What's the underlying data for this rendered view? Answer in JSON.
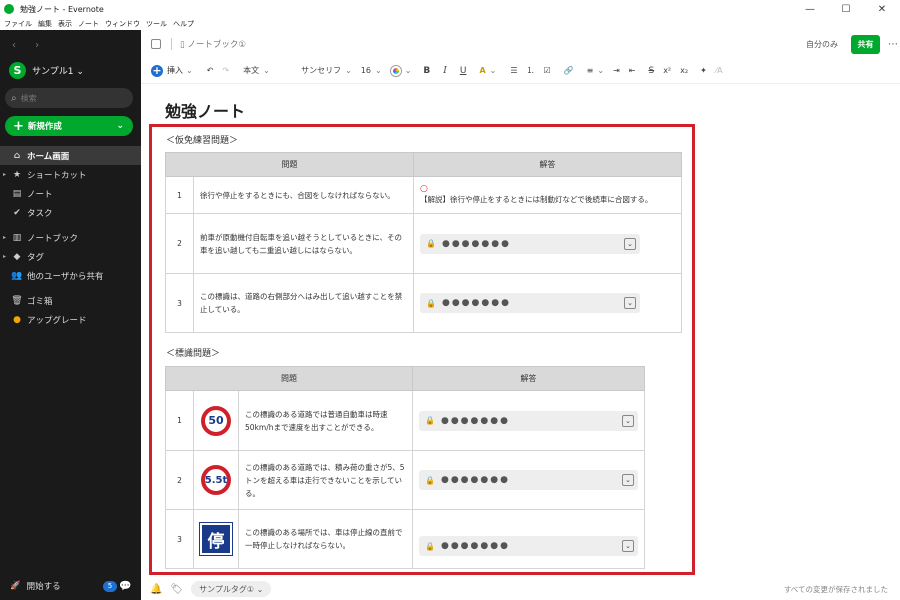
{
  "window": {
    "title": "勉強ノート - Evernote",
    "minimize": "—",
    "maximize": "☐",
    "close": "✕"
  },
  "menu": [
    "ファイル",
    "編集",
    "表示",
    "ノート",
    "ウィンドウ",
    "ツール",
    "ヘルプ"
  ],
  "sidebar": {
    "nav_arrows": "‹ ›",
    "account_initial": "S",
    "account_name": "サンプル1 ⌄",
    "search_placeholder": "検索",
    "search_icon": "⌕",
    "new_button": "新規作成",
    "items": [
      {
        "label": "ホーム画面",
        "icon": "⌂",
        "active": true
      },
      {
        "label": "ショートカット",
        "icon": "★",
        "caret": "▸"
      },
      {
        "label": "ノート",
        "icon": "▤"
      },
      {
        "label": "タスク",
        "icon": "✔"
      },
      {
        "label": "ノートブック",
        "icon": "▥",
        "caret": "▸"
      },
      {
        "label": "タグ",
        "icon": "◆",
        "caret": "▸"
      },
      {
        "label": "他のユーザから共有",
        "icon": "👥"
      },
      {
        "label": "ゴミ箱",
        "icon": "🗑"
      },
      {
        "label": "アップグレード",
        "icon": "●"
      }
    ],
    "footer_label": "開始する",
    "footer_badge": "5",
    "footer_icon": "🚀",
    "chat_icon": "💬"
  },
  "note_header": {
    "notebook": "ノートブック①",
    "notebook_icon": "▯",
    "owner": "自分のみ",
    "share": "共有",
    "more": "⋯"
  },
  "toolbar": {
    "insert": "挿入",
    "undo": "↶",
    "redo": "↷",
    "style": "本文",
    "font": "サンセリフ",
    "size": "16",
    "bold": "B",
    "italic": "I",
    "underline": "U",
    "highlight": "A",
    "bullets": "☰",
    "numbered": "⒈",
    "checklist": "☑",
    "link": "🔗",
    "align": "≡",
    "indent": "⇥",
    "outdent": "⇤",
    "strike": "S",
    "superscript": "x²",
    "subscript": "x₂",
    "magic": "✦",
    "format": "⁄A"
  },
  "note": {
    "title": "勉強ノート",
    "section1": {
      "title": "＜仮免練習問題＞",
      "headers": [
        "問題",
        "解答"
      ],
      "rows": [
        {
          "num": "1",
          "question": "徐行や停止をするときにも、合図をしなければならない。",
          "mark": "○",
          "answer": "【解説】徐行や停止をするときには制動灯などで後続車に合図する。",
          "locked": false
        },
        {
          "num": "2",
          "question": "前車が原動機付自転車を追い越そうとしているときに、その車を追い越しても二重追い越しにはならない。",
          "locked": true
        },
        {
          "num": "3",
          "question": "この標識は、道路の右側部分へはみ出して追い越すことを禁止している。",
          "locked": true
        }
      ]
    },
    "section2": {
      "title": "＜標識問題＞",
      "headers": [
        "問題",
        "解答"
      ],
      "rows": [
        {
          "num": "1",
          "sign": "50",
          "question": "この標識のある道路では普通自動車は時速50km/hまで速度を出すことができる。",
          "locked": true
        },
        {
          "num": "2",
          "sign": "5.5t",
          "question": "この標識のある道路では、積み荷の重さが5、5トンを超える車は走行できないことを示している。",
          "locked": true
        },
        {
          "num": "3",
          "sign": "停",
          "question": "この標識のある場所では、車は停止線の直前で一時停止しなければならない。",
          "locked": true
        }
      ]
    },
    "locked_dots": "●●●●●●●",
    "lock_icon": "🔒",
    "dropdown_icon": "⌄"
  },
  "bottom": {
    "tag": "サンプルタグ① ⌄",
    "bell_icon": "🔔",
    "tag_icon": "🏷",
    "saved": "すべての変更が保存されました"
  }
}
